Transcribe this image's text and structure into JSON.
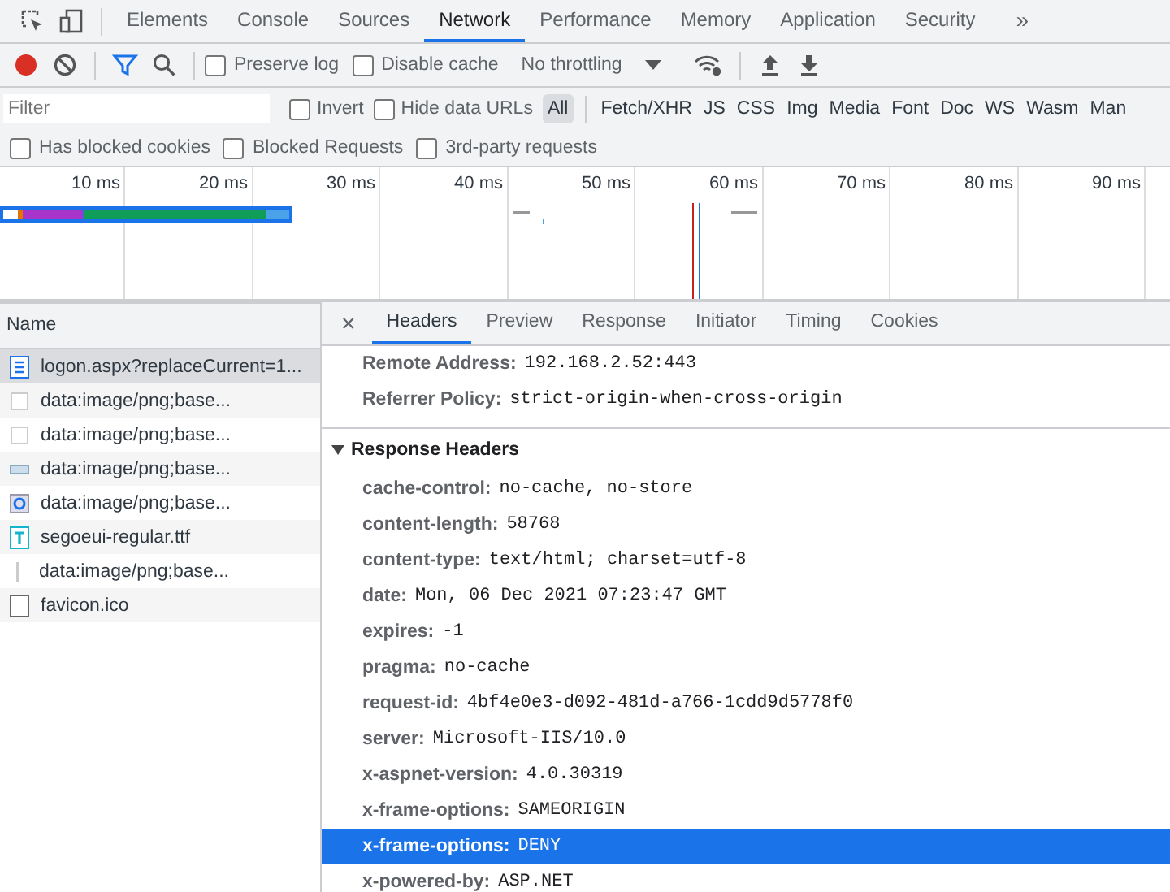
{
  "panel_tabs": [
    {
      "label": "Elements",
      "selected": false
    },
    {
      "label": "Console",
      "selected": false
    },
    {
      "label": "Sources",
      "selected": false
    },
    {
      "label": "Network",
      "selected": true
    },
    {
      "label": "Performance",
      "selected": false
    },
    {
      "label": "Memory",
      "selected": false
    },
    {
      "label": "Application",
      "selected": false
    },
    {
      "label": "Security",
      "selected": false
    }
  ],
  "overflow": "»",
  "toolbar": {
    "recording": true,
    "checkboxes": [
      {
        "label": "Preserve log",
        "checked": false
      },
      {
        "label": "Disable cache",
        "checked": false
      }
    ],
    "throttling": "No throttling"
  },
  "filter_bar": {
    "placeholder": "Filter",
    "checkboxes": [
      {
        "label": "Invert",
        "checked": false
      },
      {
        "label": "Hide data URLs",
        "checked": false
      }
    ],
    "types": [
      {
        "label": "All",
        "selected": true
      },
      {
        "label": "Fetch/XHR",
        "selected": false
      },
      {
        "label": "JS",
        "selected": false
      },
      {
        "label": "CSS",
        "selected": false
      },
      {
        "label": "Img",
        "selected": false
      },
      {
        "label": "Media",
        "selected": false
      },
      {
        "label": "Font",
        "selected": false
      },
      {
        "label": "Doc",
        "selected": false
      },
      {
        "label": "WS",
        "selected": false
      },
      {
        "label": "Wasm",
        "selected": false
      },
      {
        "label": "Man",
        "selected": false
      }
    ]
  },
  "extra_filters": [
    {
      "label": "Has blocked cookies",
      "checked": false
    },
    {
      "label": "Blocked Requests",
      "checked": false
    },
    {
      "label": "3rd-party requests",
      "checked": false
    }
  ],
  "overview": {
    "ticks": [
      "10 ms",
      "20 ms",
      "30 ms",
      "40 ms",
      "50 ms",
      "60 ms",
      "70 ms",
      "80 ms",
      "90 ms"
    ]
  },
  "requests": {
    "column": "Name",
    "rows": [
      {
        "name": "logon.aspx?replaceCurrent=1...",
        "kind": "document",
        "selected": true
      },
      {
        "name": "data:image/png;base...",
        "kind": "blank",
        "selected": false
      },
      {
        "name": "data:image/png;base...",
        "kind": "blank",
        "selected": false
      },
      {
        "name": "data:image/png;base...",
        "kind": "bar",
        "selected": false
      },
      {
        "name": "data:image/png;base...",
        "kind": "circle",
        "selected": false
      },
      {
        "name": "segoeui-regular.ttf",
        "kind": "font",
        "selected": false
      },
      {
        "name": "data:image/png;base...",
        "kind": "thin",
        "selected": false
      },
      {
        "name": "favicon.ico",
        "kind": "file",
        "selected": false
      }
    ]
  },
  "details": {
    "close": "×",
    "tabs": [
      {
        "label": "Headers",
        "selected": true
      },
      {
        "label": "Preview",
        "selected": false
      },
      {
        "label": "Response",
        "selected": false
      },
      {
        "label": "Initiator",
        "selected": false
      },
      {
        "label": "Timing",
        "selected": false
      },
      {
        "label": "Cookies",
        "selected": false
      }
    ],
    "general": [
      {
        "key": "Remote Address:",
        "value": "192.168.2.52:443"
      },
      {
        "key": "Referrer Policy:",
        "value": "strict-origin-when-cross-origin"
      }
    ],
    "response_headers": {
      "title": "Response Headers",
      "expanded": true,
      "rows": [
        {
          "key": "cache-control:",
          "value": "no-cache, no-store",
          "selected": false
        },
        {
          "key": "content-length:",
          "value": "58768",
          "selected": false
        },
        {
          "key": "content-type:",
          "value": "text/html; charset=utf-8",
          "selected": false
        },
        {
          "key": "date:",
          "value": "Mon, 06 Dec 2021 07:23:47 GMT",
          "selected": false
        },
        {
          "key": "expires:",
          "value": "-1",
          "selected": false
        },
        {
          "key": "pragma:",
          "value": "no-cache",
          "selected": false
        },
        {
          "key": "request-id:",
          "value": "4bf4e0e3-d092-481d-a766-1cdd9d5778f0",
          "selected": false
        },
        {
          "key": "server:",
          "value": "Microsoft-IIS/10.0",
          "selected": false
        },
        {
          "key": "x-aspnet-version:",
          "value": "4.0.30319",
          "selected": false
        },
        {
          "key": "x-frame-options:",
          "value": "SAMEORIGIN",
          "selected": false
        },
        {
          "key": "x-frame-options:",
          "value": "DENY",
          "selected": true
        },
        {
          "key": "x-powered-by:",
          "value": "ASP.NET",
          "selected": false
        }
      ]
    }
  }
}
